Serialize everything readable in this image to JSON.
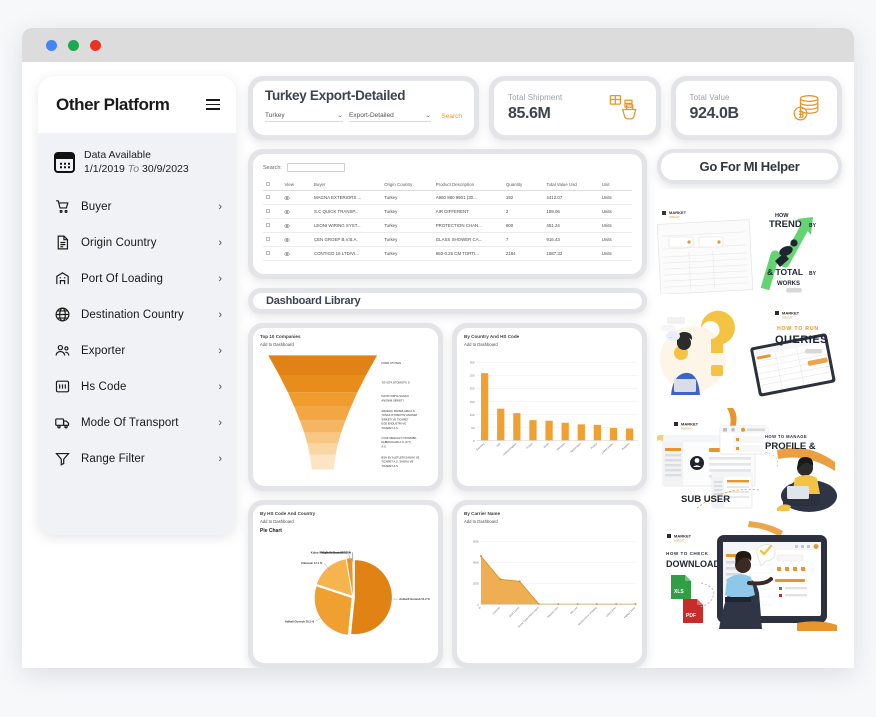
{
  "window": {
    "dots": [
      "blue",
      "green",
      "red"
    ]
  },
  "sidebar": {
    "title": "Other Platform",
    "menu_icon": "hamburger-icon",
    "data_available": {
      "label": "Data Available",
      "from": "1/1/2019",
      "to_word": "To",
      "to": "30/9/2023",
      "icon": "calendar-icon"
    },
    "items": [
      {
        "label": "Buyer",
        "icon": "cart-icon",
        "chevron": "›"
      },
      {
        "label": "Origin Country",
        "icon": "document-icon",
        "chevron": "›"
      },
      {
        "label": "Port Of Loading",
        "icon": "port-icon",
        "chevron": "›"
      },
      {
        "label": "Destination Country",
        "icon": "globe-icon",
        "chevron": "›"
      },
      {
        "label": "Exporter",
        "icon": "users-icon",
        "chevron": "›"
      },
      {
        "label": "Hs Code",
        "icon": "hscode-icon",
        "chevron": "›"
      },
      {
        "label": "Mode Of Transport",
        "icon": "truck-icon",
        "chevron": "›"
      },
      {
        "label": "Range Filter",
        "icon": "filter-icon",
        "chevron": "›"
      }
    ]
  },
  "search_card": {
    "title": "Turkey Export-Detailed",
    "country_select": "Turkey",
    "type_select": "Export-Detailed",
    "chevron": "⌄",
    "search_label": "Search"
  },
  "stats": [
    {
      "label": "Total Shipment",
      "value": "85.6M",
      "icon": "shipment-icon"
    },
    {
      "label": "Total Value",
      "value": "924.0B",
      "icon": "coins-icon"
    }
  ],
  "table": {
    "search_label": "Search:",
    "search_value": "",
    "search_placeholder": "",
    "columns": [
      "",
      "View",
      "Buyer",
      "Origin Country",
      "Product Description",
      "Quantity",
      "Total Value Usd",
      "Unit"
    ],
    "rows": [
      {
        "buyer": "MAGNA EXTERIORS ...",
        "origin": "Turkey",
        "product": "A960 880 9901 (30...",
        "qty": "192",
        "value": "4412.07",
        "unit": "Units"
      },
      {
        "buyer": "S.C QUICK TRANSP...",
        "origin": "Turkey",
        "product": "AIR DIFFERENT",
        "qty": "2",
        "value": "159.06",
        "unit": "Units"
      },
      {
        "buyer": "LEONI WIRING SYST...",
        "origin": "Turkey",
        "product": "PROTECTION CHAN...",
        "qty": "600",
        "value": "451.24",
        "unit": "Units"
      },
      {
        "buyer": "ÇEN GROEP B.V.B.A.",
        "origin": "Turkey",
        "product": "GLASS SHOWER CA...",
        "qty": "7",
        "value": "916.43",
        "unit": "Units"
      },
      {
        "buyer": "CONTIGO 16 LTD/VI...",
        "origin": "Turkey",
        "product": "650-0.25 CM TORTI...",
        "qty": "2184",
        "value": "1687.32",
        "unit": "Units"
      }
    ]
  },
  "dashboard_library": {
    "title": "Dashboard Library"
  },
  "chart_data": [
    {
      "type": "funnel",
      "title": "Top 10 Companies",
      "subtitle": "Add to Dashboard",
      "categories": [
        "FORD OTOSAN",
        "TOYOTA OTOMOTIV S",
        "HAYAT KIMYA SANAYI ANONIM SIRKETI",
        "ARCELIK PAZARLAMA A.S.",
        "TUSAS OTOMOTIV ANONIM SIRKETI",
        "EGE ENDUSTRI VE TICARET A.S.",
        "OYAK RENAULT OTOMOBIL FABRIKALARI A.S.",
        "BSH EV ALETLERI SANAYI VE TICARET A.S."
      ],
      "values": [
        100,
        84,
        70,
        58,
        48,
        40,
        33,
        28
      ]
    },
    {
      "type": "bar",
      "title": "By Country And HS Code",
      "subtitle": "Add to Dashboard",
      "categories": [
        "Germany",
        "Italy",
        "United Kingdom",
        "France",
        "Spain",
        "Romania",
        "Netherlands",
        "Poland",
        "United States",
        "Bulgaria"
      ],
      "values": [
        258,
        122,
        105,
        78,
        76,
        68,
        62,
        60,
        48,
        46
      ],
      "ylim": [
        0,
        300
      ],
      "yticks": [
        0,
        50,
        100,
        150,
        200,
        250,
        300
      ],
      "grid": true
    },
    {
      "type": "pie",
      "title": "By HS Code And Country",
      "subtitle": "Add to Dashboard",
      "chart_label": "Pie Chart",
      "labels": [
        "Ambarli Gumruk 51.2 %",
        "Halkali Gumruk 28.2 %",
        "Unknown 17.1 %",
        "Mugla Gumruk 2.3 %",
        "Kultur Mahallesi Gumruk 0.2 %",
        "Yalanbi Gumruk 0.2 %"
      ],
      "values": [
        51.2,
        28.2,
        17.1,
        2.3,
        0.2,
        0.2
      ]
    },
    {
      "type": "area",
      "title": "By Carrier Name",
      "subtitle": "Add to Dashboard",
      "categories": [
        "M",
        "Unknown",
        "MSC Carrier",
        "Grand Trade Export Import",
        "Maersk Lines",
        "Nile Line",
        "Mediterranean Shipping",
        "CMA Carrier",
        "Hapag Carrier"
      ],
      "values": [
        4600,
        2400,
        2200,
        40,
        30,
        30,
        30,
        30,
        30
      ],
      "ylim": [
        0,
        6000
      ],
      "yticks": [
        0,
        2000,
        4000,
        6000
      ],
      "grid": true
    }
  ],
  "helper": {
    "button_label": "Go For MI Helper"
  },
  "promos": [
    {
      "name": "trend-total-promo",
      "brand": "MARKET",
      "line1": "HOW",
      "line2": "TREND",
      "line2b": "BY",
      "line3": "& TOTAL",
      "line3b": "BY",
      "line4": "WORKS"
    },
    {
      "name": "queries-promo",
      "brand": "MARKET",
      "line1": "HOW TO RUN",
      "line2": "QUERIES"
    },
    {
      "name": "profile-subuser-promo",
      "brand": "MARKET",
      "line1": "HOW TO MANAGE",
      "line2": "PROFILE &",
      "line3": "SUB USER"
    },
    {
      "name": "downloads-promo",
      "brand": "MARKET",
      "line1": "HOW TO CHECK",
      "line2": "DOWNLOADS",
      "file1": "XLS",
      "file2": "PDF"
    }
  ],
  "colors": {
    "accent": "#e8952b",
    "orange_dark": "#e08214",
    "green": "#63d471",
    "yellow": "#f5c343",
    "text": "#3b4252"
  }
}
